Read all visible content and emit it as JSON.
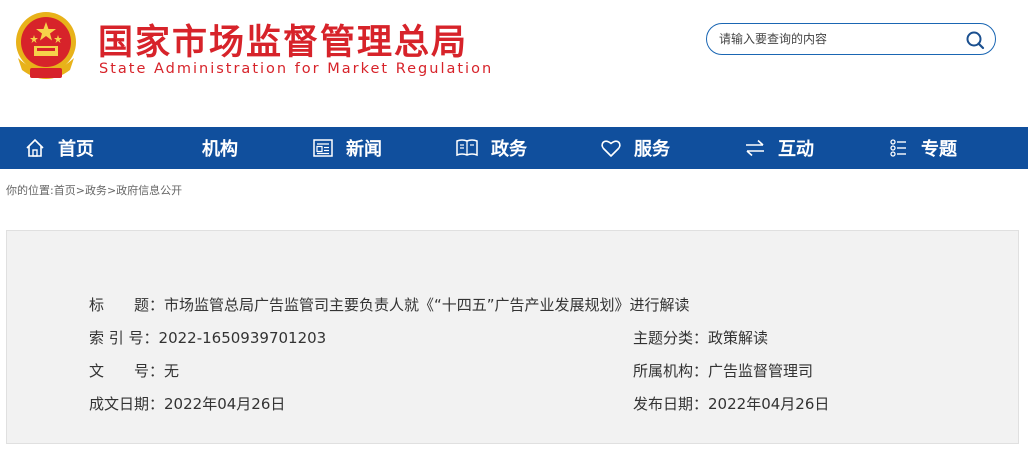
{
  "header": {
    "title": "国家市场监督管理总局",
    "subtitle": "State Administration for Market Regulation",
    "brand_color": "#d7232a"
  },
  "search": {
    "placeholder": "请输入要查询的内容"
  },
  "nav": {
    "background": "#104f9d",
    "items": [
      {
        "label": "首页",
        "icon": "home-icon"
      },
      {
        "label": "机构",
        "icon": "org-icon"
      },
      {
        "label": "新闻",
        "icon": "news-icon"
      },
      {
        "label": "政务",
        "icon": "affairs-icon"
      },
      {
        "label": "服务",
        "icon": "heart-icon"
      },
      {
        "label": "互动",
        "icon": "exchange-icon"
      },
      {
        "label": "专题",
        "icon": "topic-icon"
      }
    ]
  },
  "breadcrumb": {
    "prefix": "你的位置:",
    "items": [
      "首页",
      "政务",
      "政府信息公开"
    ],
    "separator": ">"
  },
  "info": {
    "title_label": "标　　题：",
    "title_value": "市场监管总局广告监管司主要负责人就《“十四五”广告产业发展规划》进行解读",
    "index_label": "索 引 号：",
    "index_value": "2022-1650939701203",
    "category_label": "主题分类：",
    "category_value": "政策解读",
    "doc_no_label": "文　　号：",
    "doc_no_value": "无",
    "org_label": "所属机构：",
    "org_value": "广告监督管理司",
    "written_date_label": "成文日期：",
    "written_date_value": "2022年04月26日",
    "publish_date_label": "发布日期：",
    "publish_date_value": "2022年04月26日"
  }
}
